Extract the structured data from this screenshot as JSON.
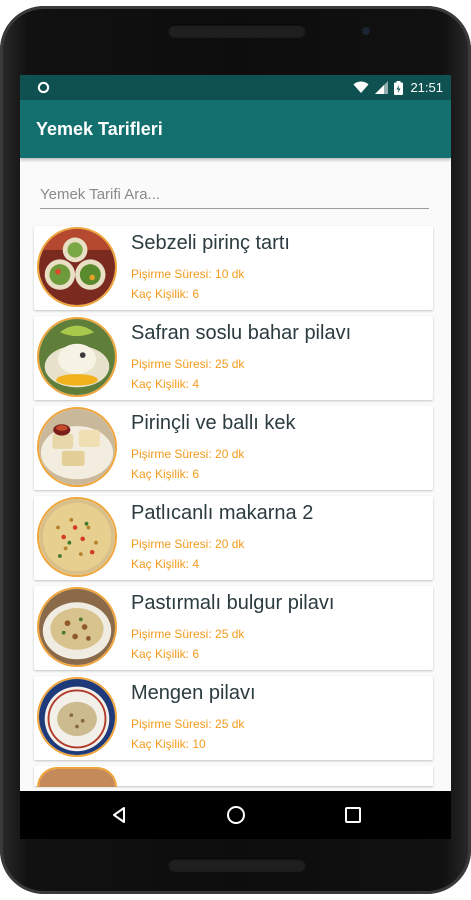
{
  "status_bar": {
    "time": "21:51"
  },
  "app_bar": {
    "title": "Yemek Tarifleri"
  },
  "search": {
    "placeholder": "Yemek Tarifi Ara..."
  },
  "recipes": [
    {
      "name": "Sebzeli pirinç tartı",
      "cook_time": "Pişirme Süresi: 10 dk",
      "servings": "Kaç Kişilik: 6"
    },
    {
      "name": "Safran soslu bahar pilavı",
      "cook_time": "Pişirme Süresi: 25 dk",
      "servings": "Kaç Kişilik: 4"
    },
    {
      "name": "Pirinçli ve ballı kek",
      "cook_time": "Pişirme Süresi: 20 dk",
      "servings": "Kaç Kişilik: 6"
    },
    {
      "name": "Patlıcanlı makarna 2",
      "cook_time": "Pişirme Süresi: 20 dk",
      "servings": "Kaç Kişilik: 4"
    },
    {
      "name": "Pastırmalı bulgur pilavı",
      "cook_time": "Pişirme Süresi: 25 dk",
      "servings": "Kaç Kişilik: 6"
    },
    {
      "name": "Mengen pilavı",
      "cook_time": "Pişirme Süresi: 25 dk",
      "servings": "Kaç Kişilik: 10"
    }
  ],
  "icons": {
    "status": [
      "notification-circle-icon",
      "wifi-icon",
      "signal-icon",
      "battery-icon"
    ],
    "navigation": [
      "back-icon",
      "home-icon",
      "recents-icon"
    ]
  },
  "colors": {
    "status_bar": "#0e5150",
    "app_bar": "#14706f",
    "accent": "#f39a1c",
    "title_text": "#2b3b3f"
  }
}
